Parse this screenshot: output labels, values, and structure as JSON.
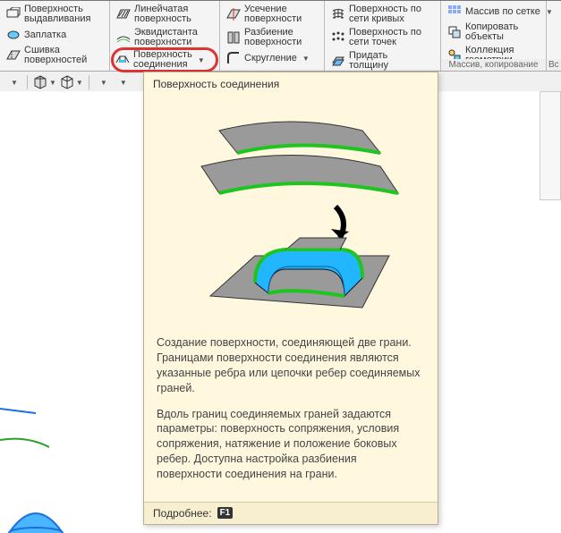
{
  "ribbon": {
    "group1": [
      {
        "icon": "extrude",
        "l1": "Поверхность",
        "l2": "выдавливания"
      },
      {
        "icon": "patch",
        "l1": "Заплатка",
        "l2": ""
      },
      {
        "icon": "stitch",
        "l1": "Сшивка",
        "l2": "поверхностей"
      }
    ],
    "group2": [
      {
        "icon": "ruled",
        "l1": "Линейчатая",
        "l2": "поверхность"
      },
      {
        "icon": "offset",
        "l1": "Эквидистанта",
        "l2": "поверхности"
      },
      {
        "icon": "conn",
        "l1": "Поверхность",
        "l2": "соединения",
        "hl": true
      }
    ],
    "group3": [
      {
        "icon": "trim",
        "l1": "Усечение",
        "l2": "поверхности"
      },
      {
        "icon": "split",
        "l1": "Разбиение",
        "l2": "поверхности"
      },
      {
        "icon": "fillet",
        "l1": "Скругление",
        "l2": ""
      }
    ],
    "group4": [
      {
        "icon": "netcrv",
        "l1": "Поверхность по",
        "l2": "сети кривых"
      },
      {
        "icon": "netpt",
        "l1": "Поверхность по",
        "l2": "сети точек"
      },
      {
        "icon": "thick",
        "l1": "Придать",
        "l2": "толщину"
      }
    ],
    "group5": {
      "items": [
        {
          "icon": "grid",
          "l1": "Массив по сетке",
          "l2": ""
        },
        {
          "icon": "copy",
          "l1": "Копировать",
          "l2": "объекты"
        },
        {
          "icon": "coll",
          "l1": "Коллекция",
          "l2": "геометрии"
        }
      ],
      "label": "Массив, копирование"
    },
    "tail": "Вс"
  },
  "tooltip": {
    "title": "Поверхность соединения",
    "p1": "Создание поверхности, соединяющей две грани. Границами поверхности соединения являются указанные ребра или цепочки ребер соединяемых граней.",
    "p2": "Вдоль границ соединяемых граней задаются параметры: поверхность сопряжения, условия сопряжения, натяжение и положение боковых ребер. Доступна настройка разбиения поверхности соединения на грани.",
    "more": "Подробнее:",
    "key": "F1"
  }
}
